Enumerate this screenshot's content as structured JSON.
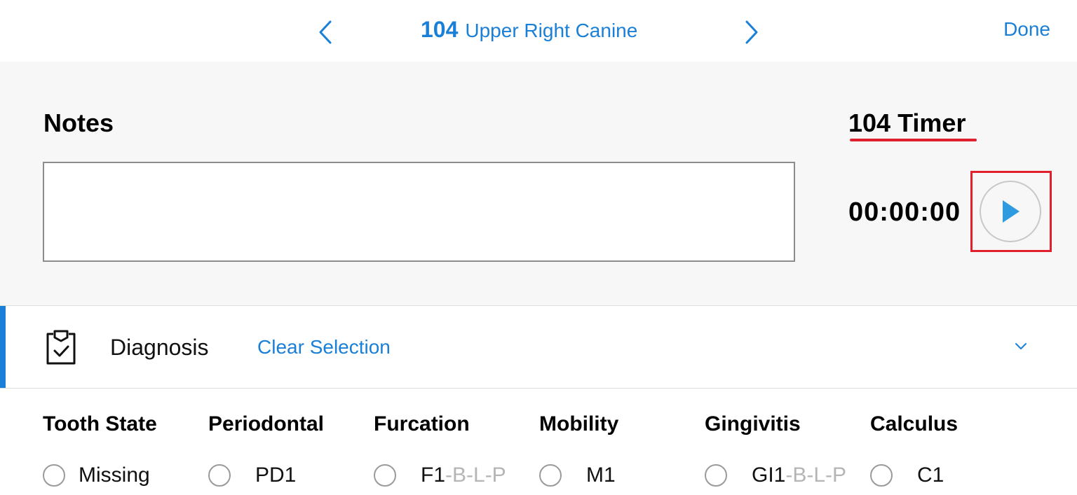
{
  "nav": {
    "tooth_number": "104",
    "tooth_name": "Upper Right Canine",
    "done_label": "Done"
  },
  "notes": {
    "label": "Notes",
    "value": ""
  },
  "timer": {
    "label": "104 Timer",
    "value": "00:00:00"
  },
  "diagnosis": {
    "label": "Diagnosis",
    "clear_label": "Clear Selection"
  },
  "columns": [
    {
      "heading": "Tooth State",
      "option": "Missing",
      "suffix": ""
    },
    {
      "heading": "Periodontal",
      "option": "PD1",
      "suffix": ""
    },
    {
      "heading": "Furcation",
      "option": "F1",
      "suffix": "-B-L-P"
    },
    {
      "heading": "Mobility",
      "option": "M1",
      "suffix": ""
    },
    {
      "heading": "Gingivitis",
      "option": "GI1",
      "suffix": "-B-L-P"
    },
    {
      "heading": "Calculus",
      "option": "C1",
      "suffix": ""
    }
  ],
  "icons": {
    "prev": "chevron-left-icon",
    "next": "chevron-right-icon",
    "play": "play-icon",
    "diagnosis": "clipboard-check-icon",
    "expand": "chevron-down-icon"
  },
  "colors": {
    "accent": "#1a7fd6",
    "highlight": "#e0202d",
    "play": "#2e9be0",
    "panel_bg": "#f7f7f7"
  }
}
